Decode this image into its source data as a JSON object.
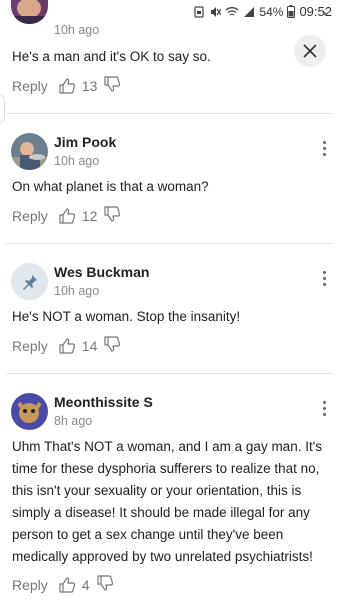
{
  "status_bar": {
    "battery": "54%",
    "time": "09:52"
  },
  "actions_common": {
    "reply_label": "Reply"
  },
  "comments": [
    {
      "author": "",
      "time": "10h ago",
      "text": "He's a man and it's OK to say so.",
      "likes": "13"
    },
    {
      "author": "Jim Pook",
      "time": "10h ago",
      "text": "On what planet is that a woman?",
      "likes": "12"
    },
    {
      "author": "Wes Buckman",
      "time": "10h ago",
      "text": "He's NOT a woman.  Stop the insanity!",
      "likes": "14"
    },
    {
      "author": "Meonthissite S",
      "time": "8h ago",
      "text": "Uhm That's NOT a woman, and I am a gay man. It's time for these dysphoria sufferers to realize that no, this isn't your sexuality or your orientation, this is simply a disease! It should be made illegal for any person to get a sex change until they've been medically approved by two unrelated psychiatrists!",
      "likes": "4"
    }
  ],
  "icons": {
    "close": "close-icon",
    "like": "thumbs-up-icon",
    "dislike": "thumbs-down-icon",
    "more": "more-vertical-icon",
    "pin_avatar": "pin-icon"
  },
  "colors": {
    "time_text": "#8a8a8a",
    "action_text": "#777777",
    "divider": "#e2e2e2",
    "pin_avatar_bg": "#dfe6ec"
  }
}
